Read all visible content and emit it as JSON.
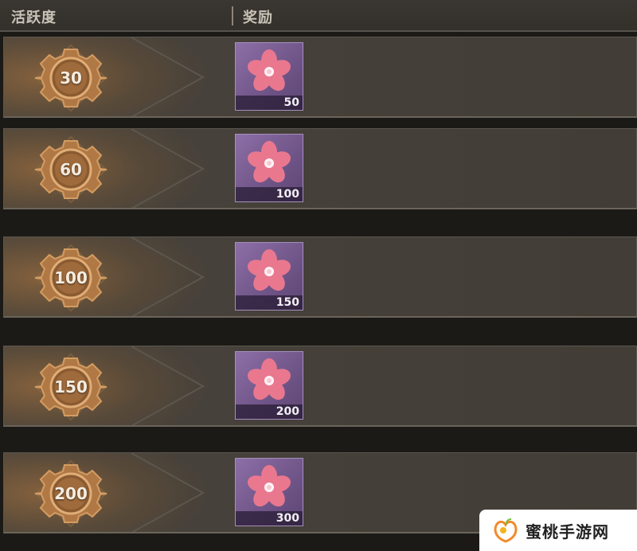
{
  "header": {
    "activity_label": "活跃度",
    "reward_label": "奖励"
  },
  "rows": [
    {
      "activity": "30",
      "reward_qty": "50",
      "reward_icon": "pink-flower-icon"
    },
    {
      "activity": "60",
      "reward_qty": "100",
      "reward_icon": "pink-flower-icon"
    },
    {
      "activity": "100",
      "reward_qty": "150",
      "reward_icon": "pink-flower-icon"
    },
    {
      "activity": "150",
      "reward_qty": "200",
      "reward_icon": "pink-flower-icon"
    },
    {
      "activity": "200",
      "reward_qty": "300",
      "reward_icon": "pink-flower-icon"
    }
  ],
  "watermark": {
    "text": "蜜桃手游网"
  },
  "colors": {
    "row_bg": "#46413a",
    "gear": "#b9834f",
    "reward_bg": "#7a5f93",
    "flower": "#e56f86"
  }
}
